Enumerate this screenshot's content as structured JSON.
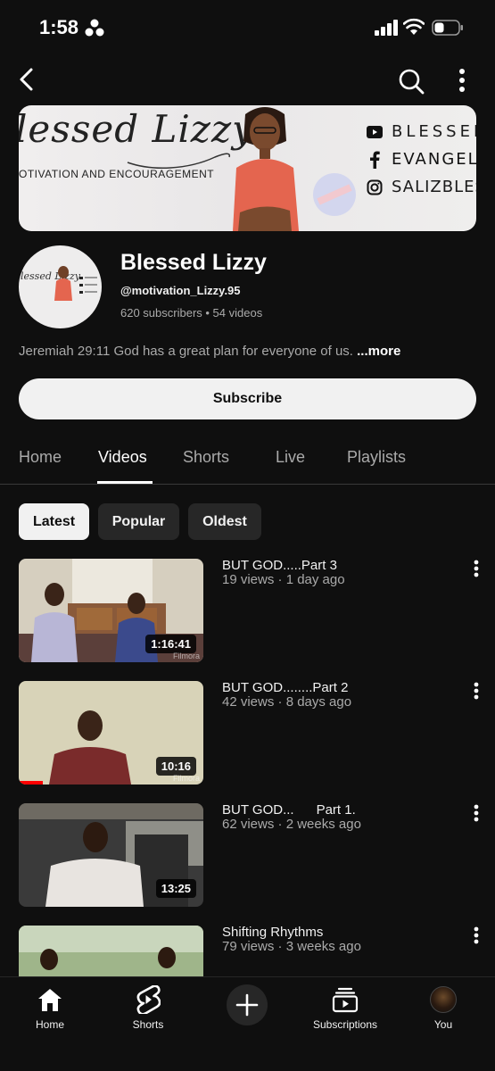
{
  "status_bar": {
    "time": "1:58"
  },
  "banner": {
    "title": "lessed Lizzy",
    "subtitle": "OTIVATION AND ENCOURAGEMENT",
    "links": [
      {
        "icon": "youtube-icon",
        "text": "BLESSED"
      },
      {
        "icon": "facebook-icon",
        "text": "EVANGELIS"
      },
      {
        "icon": "instagram-icon",
        "text": "SALIZBLES"
      }
    ]
  },
  "channel": {
    "name": "Blessed Lizzy",
    "handle": "@motivation_Lizzy.95",
    "meta": "620 subscribers  •  54 videos",
    "description": "Jeremiah 29:11 God has a great plan for everyone of us. ",
    "more": "...more",
    "avatar_text": "lessed Lizzy"
  },
  "subscribe_label": "Subscribe",
  "tabs": [
    {
      "label": "Home"
    },
    {
      "label": "Videos",
      "active": true
    },
    {
      "label": "Shorts"
    },
    {
      "label": "Live"
    },
    {
      "label": "Playlists"
    }
  ],
  "chips": [
    {
      "label": "Latest",
      "selected": true
    },
    {
      "label": "Popular"
    },
    {
      "label": "Oldest"
    }
  ],
  "videos": [
    {
      "title": "BUT GOD.....Part 3",
      "meta": "19 views · 1 day ago",
      "duration": "1:16:41"
    },
    {
      "title": "BUT GOD........Part 2",
      "meta": "42 views · 8 days ago",
      "duration": "10:16",
      "progress": 0.13
    },
    {
      "title": "BUT GOD...      Part 1.",
      "meta": "62 views · 2 weeks ago",
      "duration": "13:25"
    },
    {
      "title": "Shifting Rhythms",
      "meta": "79 views · 3 weeks ago",
      "duration": ""
    }
  ],
  "bottom_nav": [
    {
      "label": "Home",
      "icon": "home-icon"
    },
    {
      "label": "Shorts",
      "icon": "shorts-icon"
    },
    {
      "label": "",
      "icon": "create-icon"
    },
    {
      "label": "Subscriptions",
      "icon": "subscriptions-icon"
    },
    {
      "label": "You",
      "icon": "avatar"
    }
  ],
  "colors": {
    "background": "#0f0f0f",
    "chip_bg": "#272727",
    "progress_red": "#ff0000"
  }
}
